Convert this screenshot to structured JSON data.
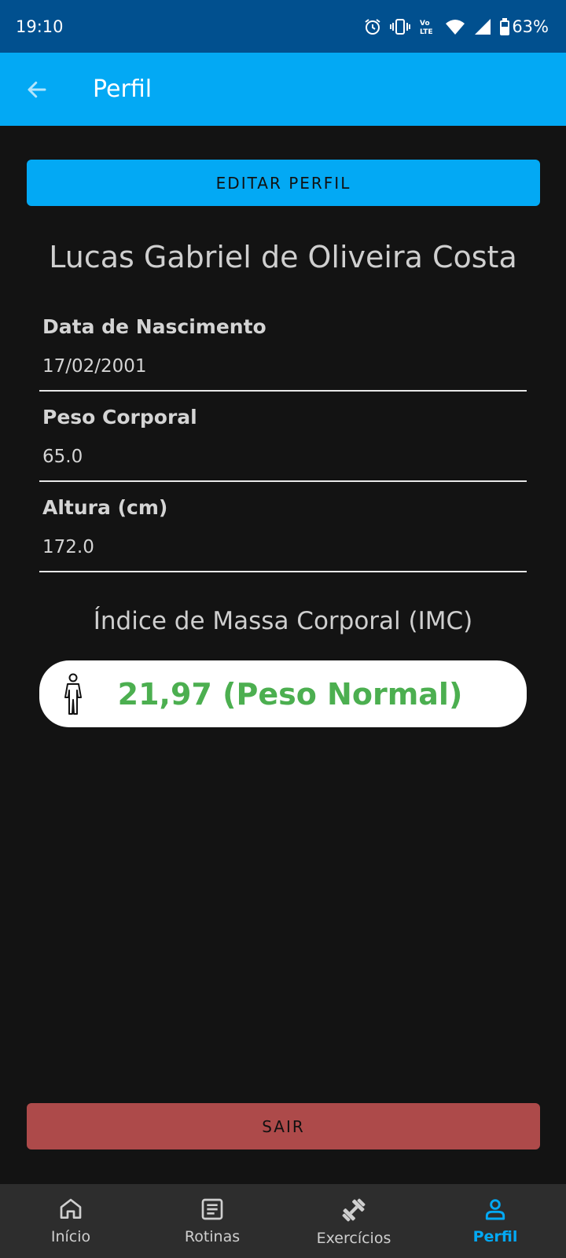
{
  "status_bar": {
    "time": "19:10",
    "battery": "63%"
  },
  "app_bar": {
    "title": "Perfil"
  },
  "buttons": {
    "edit_profile": "EDITAR PERFIL",
    "logout": "SAIR"
  },
  "profile": {
    "name": "Lucas Gabriel de Oliveira Costa",
    "fields": [
      {
        "label": "Data de Nascimento",
        "value": "17/02/2001"
      },
      {
        "label": "Peso Corporal",
        "value": "65.0"
      },
      {
        "label": "Altura (cm)",
        "value": "172.0"
      }
    ]
  },
  "imc": {
    "title": "Índice de Massa Corporal (IMC)",
    "value": "21,97 (Peso Normal)",
    "color": "#4caf50"
  },
  "bottom_nav": {
    "items": [
      {
        "label": "Início",
        "icon": "home-icon"
      },
      {
        "label": "Rotinas",
        "icon": "list-icon"
      },
      {
        "label": "Exercícios",
        "icon": "dumbbell-icon"
      },
      {
        "label": "Perfil",
        "icon": "person-icon",
        "active": true
      }
    ]
  },
  "colors": {
    "accent": "#03a9f4",
    "status_bar": "#01508f",
    "logout": "#ad4a4a",
    "background": "#131313"
  }
}
